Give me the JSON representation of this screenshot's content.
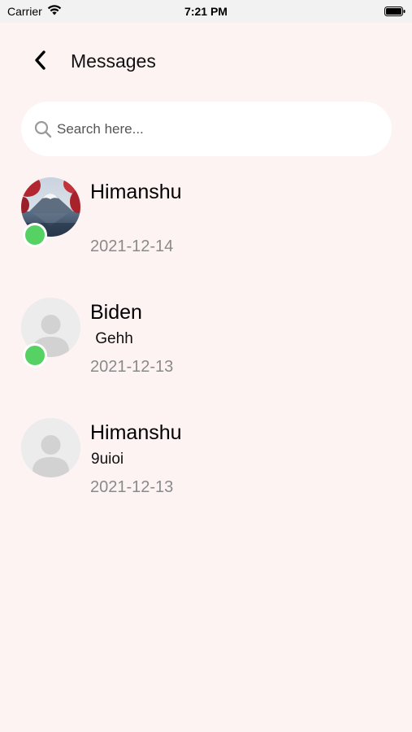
{
  "status_bar": {
    "carrier": "Carrier",
    "time": "7:21 PM"
  },
  "header": {
    "title": "Messages"
  },
  "search": {
    "placeholder": "Search here...",
    "value": ""
  },
  "chats": [
    {
      "name": "Himanshu",
      "preview": "",
      "date": "2021-12-14",
      "online": true,
      "avatar": "landscape-photo"
    },
    {
      "name": "Biden",
      "preview": " Gehh",
      "date": "2021-12-13",
      "online": true,
      "avatar": "default-person"
    },
    {
      "name": "Himanshu",
      "preview": "9uioi",
      "date": "2021-12-13",
      "online": false,
      "avatar": "default-person"
    }
  ],
  "colors": {
    "background": "#fdf3f3",
    "online": "#56d264",
    "date_text": "#8a8a8a"
  }
}
